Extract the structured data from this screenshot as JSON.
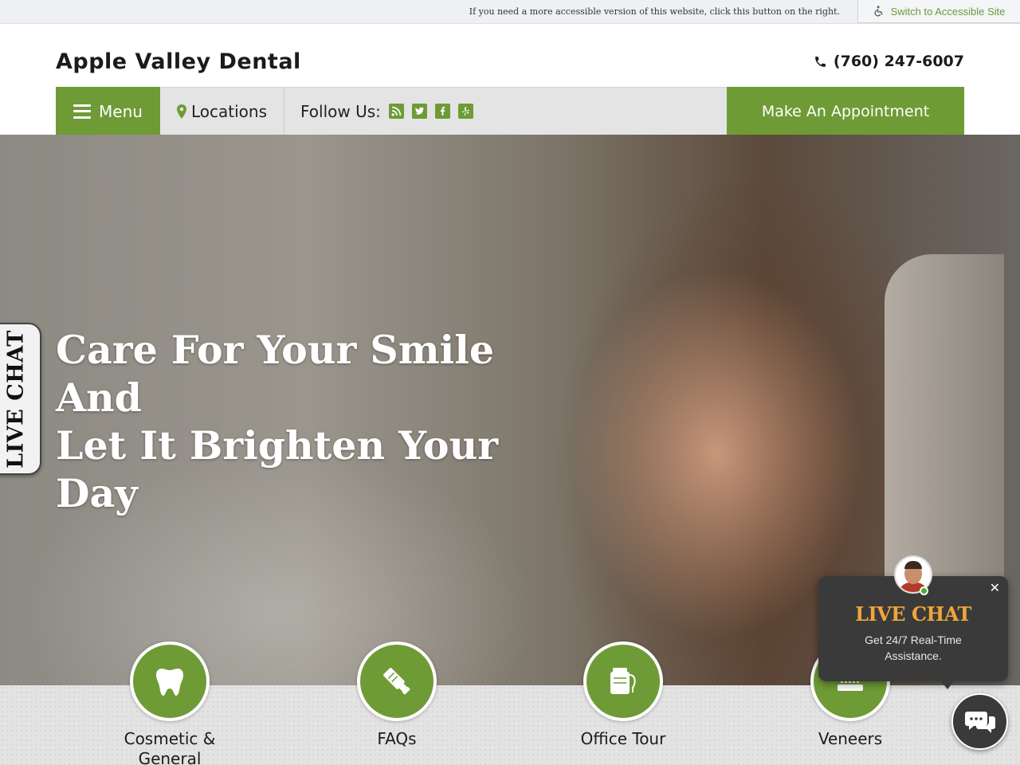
{
  "topbar": {
    "notice": "If you need a more accessible version of this website, click this button on the right.",
    "switch_label": "Switch to Accessible Site"
  },
  "header": {
    "site_title": "Apple Valley Dental",
    "phone": "(760) 247-6007"
  },
  "nav": {
    "menu_label": "Menu",
    "locations_label": "Locations",
    "follow_label": "Follow Us:",
    "social_icons": [
      "rss-icon",
      "twitter-icon",
      "facebook-icon",
      "yelp-icon"
    ],
    "appointment_label": "Make An Appointment"
  },
  "hero": {
    "headline_line1": "Care For Your Smile And",
    "headline_line2": "Let It Brighten Your Day"
  },
  "side_chat": {
    "label": "LIVE CHAT"
  },
  "services": [
    {
      "label_line1": "Cosmetic &",
      "label_line2": "General",
      "icon": "tooth-icon"
    },
    {
      "label_line1": "FAQs",
      "label_line2": "",
      "icon": "toothpaste-icon"
    },
    {
      "label_line1": "Office Tour",
      "label_line2": "",
      "icon": "floss-icon"
    },
    {
      "label_line1": "Veneers",
      "label_line2": "",
      "icon": "toothbrush-icon"
    }
  ],
  "chat_popup": {
    "title": "LIVE CHAT",
    "subtitle": "Get 24/7 Real-Time Assistance.",
    "close": "✕"
  },
  "colors": {
    "brand_green": "#6e9b35",
    "chat_accent": "#f0a53a",
    "chat_bg": "#3a3a3a"
  }
}
